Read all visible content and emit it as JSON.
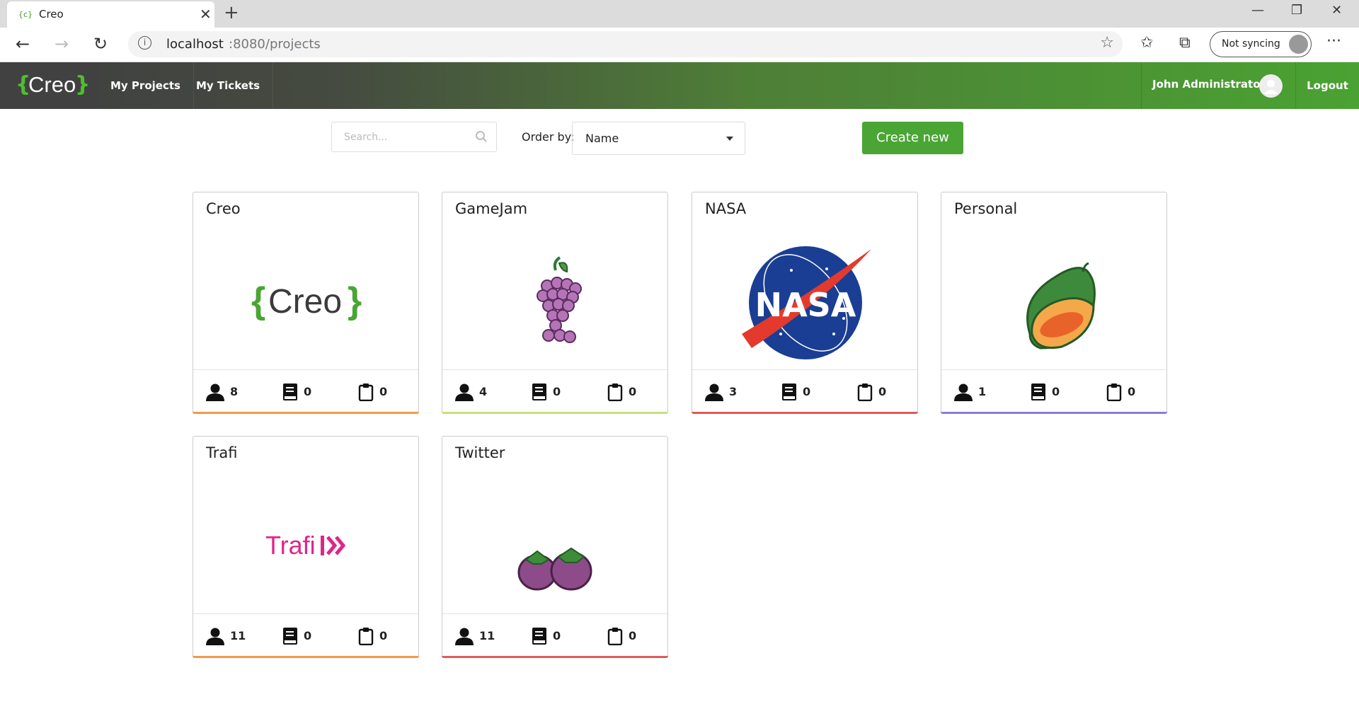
{
  "browser": {
    "tab_title": "Creo",
    "favicon_text": "{c}",
    "url_host": "localhost",
    "url_path": ":8080/projects",
    "sync_label": "Not syncing"
  },
  "header": {
    "logo_text": "Creo",
    "nav": [
      "My Projects",
      "My Tickets"
    ],
    "user_name": "John Administrator",
    "logout": "Logout"
  },
  "toolbar": {
    "search_placeholder": "Search...",
    "order_label": "Order by:",
    "order_value": "Name",
    "create_label": "Create new"
  },
  "projects": [
    {
      "name": "Creo",
      "members": "8",
      "docs": "0",
      "tickets": "0",
      "image": "creo-logo",
      "color": "#f2994a"
    },
    {
      "name": "GameJam",
      "members": "4",
      "docs": "0",
      "tickets": "0",
      "image": "grapes",
      "color": "#c8e07a"
    },
    {
      "name": "NASA",
      "members": "3",
      "docs": "0",
      "tickets": "0",
      "image": "nasa-logo",
      "color": "#e05a5a"
    },
    {
      "name": "Personal",
      "members": "1",
      "docs": "0",
      "tickets": "0",
      "image": "papaya",
      "color": "#8a7be0"
    },
    {
      "name": "Trafi",
      "members": "11",
      "docs": "0",
      "tickets": "0",
      "image": "trafi-logo",
      "color": "#f2994a"
    },
    {
      "name": "Twitter",
      "members": "11",
      "docs": "0",
      "tickets": "0",
      "image": "mangosteens",
      "color": "#e05a5a"
    }
  ],
  "card_images": {
    "creo_text": "Creo",
    "trafi_text": "Trafi",
    "nasa_text": "NASA"
  }
}
